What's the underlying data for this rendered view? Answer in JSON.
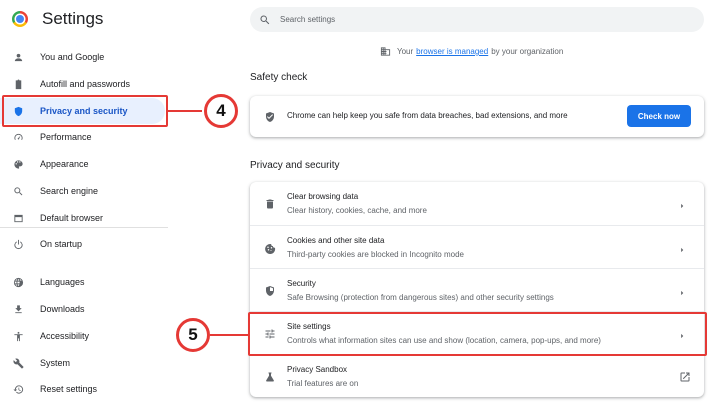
{
  "header": {
    "title": "Settings",
    "search_placeholder": "Search settings"
  },
  "sidebar": {
    "items": [
      {
        "label": "You and Google",
        "icon": "person-icon"
      },
      {
        "label": "Autofill and passwords",
        "icon": "clipboard-icon"
      },
      {
        "label": "Privacy and security",
        "icon": "shield-icon",
        "active": true
      },
      {
        "label": "Performance",
        "icon": "speedometer-icon"
      },
      {
        "label": "Appearance",
        "icon": "palette-icon"
      },
      {
        "label": "Search engine",
        "icon": "search-icon"
      },
      {
        "label": "Default browser",
        "icon": "browser-icon"
      },
      {
        "label": "On startup",
        "icon": "power-icon"
      },
      {
        "label": "Languages",
        "icon": "globe-icon"
      },
      {
        "label": "Downloads",
        "icon": "download-icon"
      },
      {
        "label": "Accessibility",
        "icon": "accessibility-icon"
      },
      {
        "label": "System",
        "icon": "wrench-icon"
      },
      {
        "label": "Reset settings",
        "icon": "reset-icon"
      }
    ]
  },
  "managed_notice": {
    "prefix": "Your",
    "link": "browser is managed",
    "suffix": "by your organization"
  },
  "safety_check": {
    "title": "Safety check",
    "text": "Chrome can help keep you safe from data breaches, bad extensions, and more",
    "button": "Check now"
  },
  "privacy": {
    "title": "Privacy and security",
    "rows": [
      {
        "title": "Clear browsing data",
        "subtitle": "Clear history, cookies, cache, and more",
        "icon": "trash-icon"
      },
      {
        "title": "Cookies and other site data",
        "subtitle": "Third-party cookies are blocked in Incognito mode",
        "icon": "cookie-icon"
      },
      {
        "title": "Security",
        "subtitle": "Safe Browsing (protection from dangerous sites) and other security settings",
        "icon": "shield-icon"
      },
      {
        "title": "Site settings",
        "subtitle": "Controls what information sites can use and show (location, camera, pop-ups, and more)",
        "icon": "tune-icon"
      },
      {
        "title": "Privacy Sandbox",
        "subtitle": "Trial features are on",
        "icon": "flask-icon"
      }
    ]
  },
  "annotations": {
    "step_a": "4",
    "step_b": "5",
    "color": "#e53935"
  },
  "colors": {
    "accent": "#1a73e8",
    "active_bg": "#e8f0fe"
  }
}
